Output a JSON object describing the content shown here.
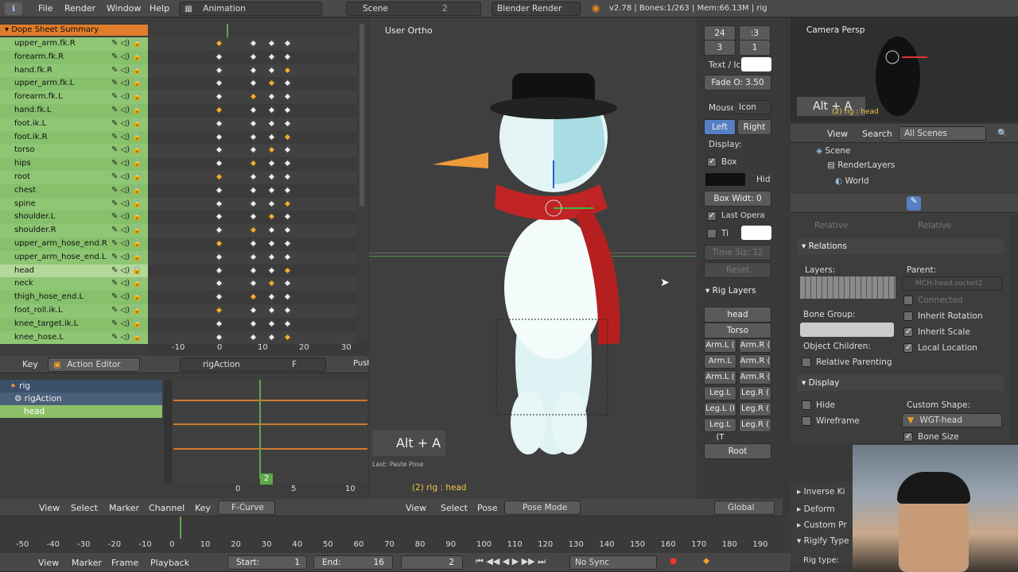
{
  "topbar": {
    "menus": [
      "File",
      "Render",
      "Window",
      "Help"
    ],
    "layout": "Animation",
    "scene": "Scene",
    "scene_num": "2",
    "engine": "Blender Render",
    "info": "v2.78 | Bones:1/263 | Mem:66.13M | rig"
  },
  "dopesheet": {
    "summary": "Dope Sheet Summary",
    "channels": [
      "upper_arm.fk.R",
      "forearm.fk.R",
      "hand.fk.R",
      "upper_arm.fk.L",
      "forearm.fk.L",
      "hand.fk.L",
      "foot.ik.L",
      "foot.ik.R",
      "torso",
      "hips",
      "root",
      "chest",
      "spine",
      "shoulder.L",
      "shoulder.R",
      "upper_arm_hose_end.R",
      "upper_arm_hose_end.L",
      "head",
      "neck",
      "thigh_hose_end.L",
      "foot_roll.ik.L",
      "knee_target.ik.L",
      "knee_hose.L"
    ],
    "selected": "head",
    "ruler": [
      "-10",
      "0",
      "10",
      "20",
      "30"
    ],
    "current_frame": "2",
    "header": {
      "key": "Key",
      "mode": "Action Editor",
      "action": "rigAction",
      "f": "F",
      "push": "Push"
    }
  },
  "graph": {
    "tree": [
      "rig",
      "rigAction",
      "head"
    ],
    "ruler": [
      "0",
      "5",
      "10"
    ],
    "frame": "2",
    "header": [
      "View",
      "Select",
      "Marker",
      "Channel",
      "Key"
    ],
    "mode": "F-Curve"
  },
  "viewport": {
    "title": "User Ortho",
    "hint": "Alt + A",
    "last_op": "Last: Paste Pose",
    "status": "(2) rig : head",
    "header": [
      "View",
      "Select",
      "Pose"
    ],
    "mode": "Pose Mode",
    "orientation": "Global"
  },
  "toolpanel": {
    "n1": "24",
    "n2": ":3",
    "n3": "3",
    "n4": "1",
    "text_label": "Text / Ic",
    "fade": "Fade O: 3.50",
    "mouse_label": "Mouse",
    "mouse_val": "Icon",
    "left": "Left",
    "right": "Right",
    "display": "Display:",
    "box": "Box",
    "hid": "Hid",
    "boxw": "Box Widt: 0",
    "last_op": "Last Opera",
    "ti": "Ti",
    "time_sz": "Time Siz: 12",
    "reset": "Reset",
    "rig_layers": "Rig Layers",
    "layer_btns": [
      "head",
      "Torso"
    ],
    "arm_btns": [
      "Arm.L (",
      "Arm.R (",
      "Arm.L (I",
      "Arm.R (",
      "Arm.L (",
      "Arm.R (",
      "Leg.L (F",
      "Leg.R (",
      "Leg.L (I",
      "Leg.R (",
      "Leg.L (T",
      "Leg.R ("
    ],
    "root": "Root"
  },
  "camera": {
    "title": "Camera Persp",
    "hint": "Alt + A",
    "status": "(2) rig : head"
  },
  "outliner": {
    "view": "View",
    "search": "Search",
    "scenes": "All Scenes",
    "items": [
      "Scene",
      "RenderLayers",
      "World"
    ]
  },
  "props": {
    "relative1": "Relative",
    "relative2": "Relative",
    "relations": "Relations",
    "layers": "Layers:",
    "parent": "Parent:",
    "parent_val": "MCH-head.socket2",
    "connected": "Connected",
    "bone_group": "Bone Group:",
    "inherit_rot": "Inherit Rotation",
    "inherit_scale": "Inherit Scale",
    "local_loc": "Local Location",
    "obj_children": "Object Children:",
    "rel_parenting": "Relative Parenting",
    "display": "Display",
    "hide": "Hide",
    "wireframe": "Wireframe",
    "custom_shape": "Custom Shape:",
    "shape_val": "WGT-head",
    "bone_size": "Bone Size",
    "inverse": "Inverse Ki",
    "deform": "Deform",
    "custom_pr": "Custom Pr",
    "rigify": "Rigify Type",
    "rig_type": "Rig type:"
  },
  "timeline": {
    "ruler": [
      "-50",
      "-40",
      "-30",
      "-20",
      "-10",
      "0",
      "10",
      "20",
      "30",
      "40",
      "50",
      "60",
      "70",
      "80",
      "90",
      "100",
      "110",
      "120",
      "130",
      "140",
      "150",
      "160",
      "170",
      "180",
      "190"
    ],
    "menus": [
      "View",
      "Marker",
      "Frame",
      "Playback"
    ],
    "start_label": "Start:",
    "start": "1",
    "end_label": "End:",
    "end": "16",
    "current": "2",
    "sync": "No Sync"
  }
}
